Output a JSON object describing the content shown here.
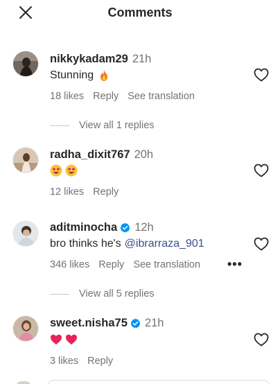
{
  "header": {
    "title": "Comments",
    "close_icon": "close-icon"
  },
  "colors": {
    "muted": "#737373",
    "mention": "#385185",
    "verified": "#0095f6",
    "heart_emoji": "#e8225d"
  },
  "comments": [
    {
      "username": "nikkykadam29",
      "time": "21h",
      "verified": false,
      "text": "Stunning",
      "emojis": [
        "fire-emoji"
      ],
      "likes": "18 likes",
      "reply": "Reply",
      "translation": "See translation",
      "view_replies": "View all 1 replies"
    },
    {
      "username": "radha_dixit767",
      "time": "20h",
      "verified": false,
      "text": "",
      "emojis": [
        "heart-eyes-emoji",
        "heart-eyes-emoji"
      ],
      "likes": "12 likes",
      "reply": "Reply"
    },
    {
      "username": "aditminocha",
      "time": "12h",
      "verified": true,
      "text": "bro thinks he's",
      "mention": "@ibrarraza_901",
      "likes": "346 likes",
      "reply": "Reply",
      "translation": "See translation",
      "more": "•••",
      "view_replies": "View all 5 replies"
    },
    {
      "username": "sweet.nisha75",
      "time": "21h",
      "verified": true,
      "text": "",
      "emojis": [
        "red-heart-emoji",
        "red-heart-emoji"
      ],
      "likes": "3 likes",
      "reply": "Reply"
    }
  ]
}
